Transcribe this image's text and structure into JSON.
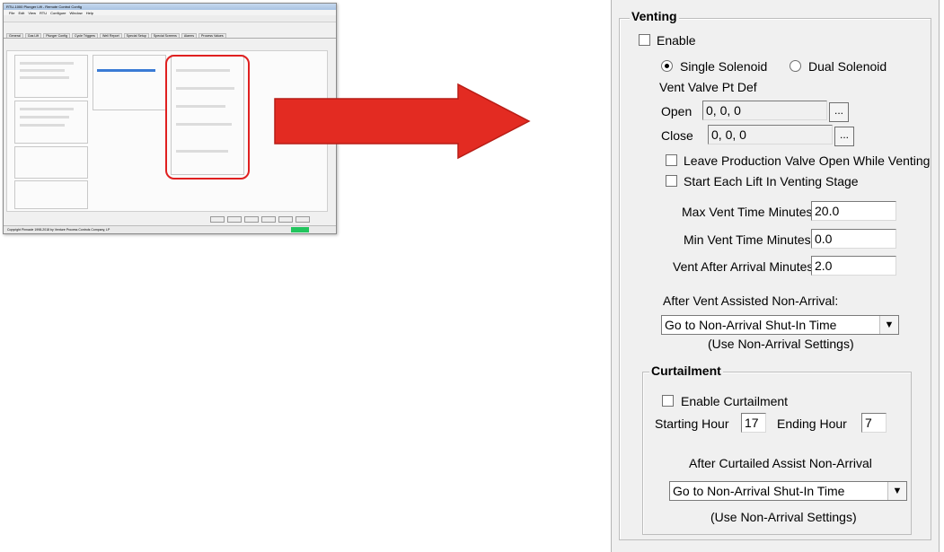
{
  "thumbnail": {
    "title": "RTU-1000 Plunger Lift - Remote Control Config",
    "menu": [
      "File",
      "Edit",
      "View",
      "RTU",
      "Configure",
      "Window",
      "Help"
    ],
    "tabs": [
      "General",
      "Gas Lift",
      "Plunger Config",
      "Cycle Triggers",
      "Well Report",
      "Special Setup",
      "Special Screens",
      "Alarms",
      "Process Values"
    ],
    "status": "Copyright Pinnacle 1998-2018 by Venture Process Controls Company, LP"
  },
  "colors": {
    "arrow": "#e32b22",
    "highlight": "#e02020",
    "status_green": "#22c55e"
  },
  "venting": {
    "legend": "Venting",
    "enable_label": "Enable",
    "enable_checked": false,
    "single_solenoid_label": "Single Solenoid",
    "dual_solenoid_label": "Dual Solenoid",
    "solenoid_selected": "single",
    "vent_valve_label": "Vent Valve Pt Def",
    "open_label": "Open",
    "open_value": "0, 0, 0",
    "close_label": "Close",
    "close_value": "0, 0, 0",
    "browse_label": "...",
    "leave_open_label": "Leave Production Valve Open While Venting",
    "start_each_lift_label": "Start Each Lift In Venting Stage",
    "max_vent_label": "Max Vent Time Minutes:",
    "max_vent_value": "20.0",
    "min_vent_label": "Min Vent Time Minutes:",
    "min_vent_value": "0.0",
    "vent_after_label": "Vent After Arrival Minutes:",
    "vent_after_value": "2.0",
    "after_vent_label": "After Vent Assisted Non-Arrival:",
    "after_vent_selected": "Go to Non-Arrival Shut-In Time",
    "after_vent_note": "(Use Non-Arrival Settings)"
  },
  "curtailment": {
    "legend": "Curtailment",
    "enable_label": "Enable Curtailment",
    "enable_checked": false,
    "starting_hour_label": "Starting Hour",
    "starting_hour_value": "17",
    "ending_hour_label": "Ending Hour",
    "ending_hour_value": "7",
    "after_label": "After Curtailed Assist Non-Arrival",
    "after_selected": "Go to Non-Arrival Shut-In Time",
    "after_note": "(Use Non-Arrival Settings)"
  }
}
